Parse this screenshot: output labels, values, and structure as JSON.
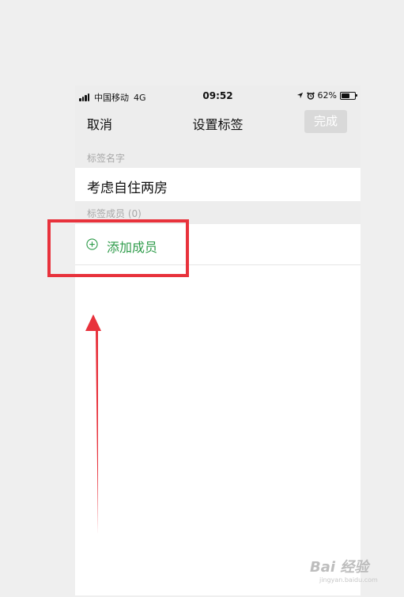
{
  "status_bar": {
    "carrier": "中国移动",
    "network": "4G",
    "time": "09:52",
    "battery": "62%",
    "battery_level": 0.62
  },
  "nav": {
    "cancel_label": "取消",
    "title": "设置标签",
    "done_label": "完成"
  },
  "tag_name": {
    "section_label": "标签名字",
    "value": "考虑自住两房"
  },
  "members": {
    "section_label": "标签成员 (0)",
    "add_label": "添加成员"
  },
  "watermark": {
    "brand": "Bai 经验",
    "url": "jingyan.baidu.com"
  },
  "colors": {
    "accent_green": "#2e9b4a",
    "highlight_red": "#e8323c",
    "done_disabled_bg": "#d9d9d9"
  }
}
